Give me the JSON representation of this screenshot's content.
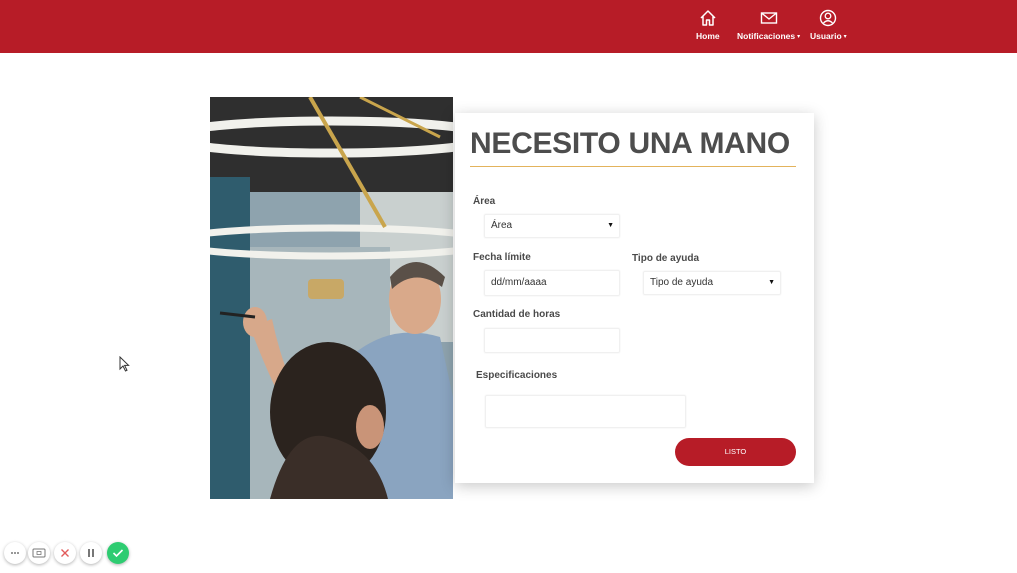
{
  "header": {
    "nav": [
      {
        "label": "Home",
        "icon": "home-icon"
      },
      {
        "label": "Notificaciones",
        "icon": "envelope-icon",
        "has_dropdown": true
      },
      {
        "label": "Usuario",
        "icon": "user-icon",
        "has_dropdown": true
      }
    ],
    "dropdown_caret": "▾"
  },
  "form": {
    "title": "NECESITO UNA MANO",
    "area_label": "Área",
    "area_value": "Área",
    "fecha_label": "Fecha límite",
    "fecha_placeholder": "dd/mm/aaaa",
    "tipo_label": "Tipo de ayuda",
    "tipo_value": "Tipo de ayuda",
    "horas_label": "Cantidad de horas",
    "horas_value": "",
    "espec_label": "Especificaciones",
    "espec_value": "",
    "submit_label": "LISTO"
  },
  "colors": {
    "brand": "#b71c27",
    "title_text": "#4d4d4d",
    "title_underline": "#e3b35c"
  },
  "recorder_toolbar": {
    "buttons": [
      "more-icon",
      "camera-icon",
      "close-icon",
      "pause-icon",
      "check-icon"
    ]
  }
}
